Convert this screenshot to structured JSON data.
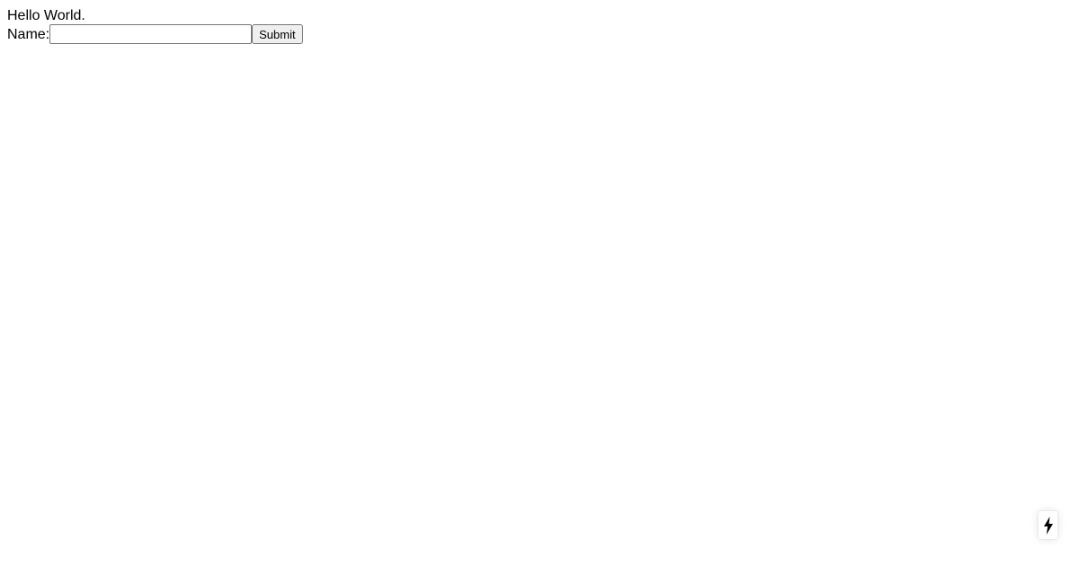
{
  "page": {
    "greeting": "Hello World."
  },
  "form": {
    "name_label": "Name:",
    "name_value": "",
    "name_placeholder": "",
    "submit_label": "Submit"
  },
  "overlay": {
    "indicator_icon": "lightning-bolt-icon"
  },
  "colors": {
    "background": "#ffffff",
    "text": "#000000",
    "button_background": "#efefef",
    "border": "#767676"
  }
}
